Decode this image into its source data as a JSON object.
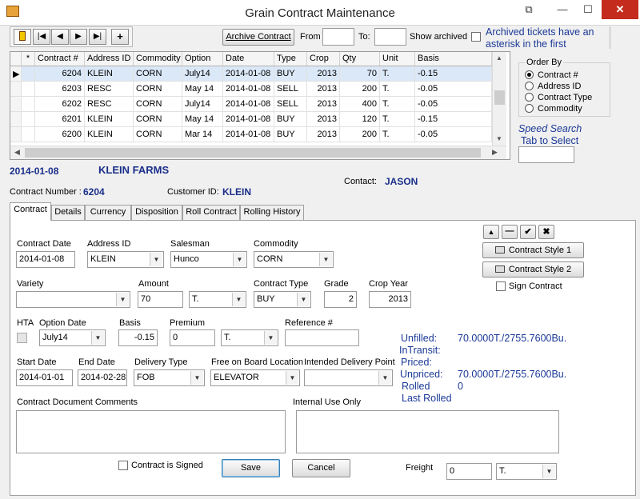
{
  "window": {
    "title": "Grain Contract Maintenance"
  },
  "toolbar": {
    "archive_button": "Archive Contract",
    "from_label": "From",
    "from_value": "",
    "to_label": "To:",
    "to_value": "",
    "show_archived_label": "Show archived",
    "show_archived_checked": false,
    "archived_note": "Archived tickets have an asterisk in the first"
  },
  "grid": {
    "columns": [
      "*",
      "Contract #",
      "Address ID",
      "Commodity",
      "Option",
      "Date",
      "Type",
      "Crop",
      "Qty",
      "Unit",
      "Basis"
    ],
    "rows": [
      {
        "star": "",
        "contract": "6204",
        "address": "KLEIN",
        "commodity": "CORN",
        "option": "July14",
        "date": "2014-01-08",
        "type": "BUY",
        "crop": "2013",
        "qty": "70",
        "unit": "T.",
        "basis": "-0.15",
        "selected": true
      },
      {
        "star": "",
        "contract": "6203",
        "address": "RESC",
        "commodity": "CORN",
        "option": "May 14",
        "date": "2014-01-08",
        "type": "SELL",
        "crop": "2013",
        "qty": "200",
        "unit": "T.",
        "basis": "-0.05"
      },
      {
        "star": "",
        "contract": "6202",
        "address": "RESC",
        "commodity": "CORN",
        "option": "July14",
        "date": "2014-01-08",
        "type": "SELL",
        "crop": "2013",
        "qty": "400",
        "unit": "T.",
        "basis": "-0.05"
      },
      {
        "star": "",
        "contract": "6201",
        "address": "KLEIN",
        "commodity": "CORN",
        "option": "May 14",
        "date": "2014-01-08",
        "type": "BUY",
        "crop": "2013",
        "qty": "120",
        "unit": "T.",
        "basis": "-0.15"
      },
      {
        "star": "",
        "contract": "6200",
        "address": "KLEIN",
        "commodity": "CORN",
        "option": "Mar 14",
        "date": "2014-01-08",
        "type": "BUY",
        "crop": "2013",
        "qty": "200",
        "unit": "T.",
        "basis": "-0.05"
      }
    ]
  },
  "order_by": {
    "title": "Order By",
    "options": [
      "Contract #",
      "Address ID",
      "Contract Type",
      "Commodity"
    ],
    "selected": "Contract #"
  },
  "speed_search": {
    "label": "Speed Search",
    "hint": "Tab to Select",
    "value": ""
  },
  "header": {
    "date": "2014-01-08",
    "customer_name": "KLEIN FARMS",
    "contact_label": "Contact:",
    "contact_value": "JASON",
    "contract_number_label": "Contract Number :",
    "contract_number_value": "6204",
    "customer_id_label": "Customer ID:",
    "customer_id_value": "KLEIN"
  },
  "tabs": [
    "Contract",
    "Details",
    "Currency",
    "Disposition",
    "Roll Contract",
    "Rolling History"
  ],
  "active_tab": "Contract",
  "form": {
    "contract_date": {
      "label": "Contract Date",
      "value": "2014-01-08"
    },
    "address_id": {
      "label": "Address ID",
      "value": "KLEIN"
    },
    "salesman": {
      "label": "Salesman",
      "value": "Hunco"
    },
    "commodity": {
      "label": "Commodity",
      "value": "CORN"
    },
    "variety": {
      "label": "Variety",
      "value": ""
    },
    "amount": {
      "label": "Amount",
      "value": "70",
      "unit": "T."
    },
    "contract_type": {
      "label": "Contract Type",
      "value": "BUY"
    },
    "grade": {
      "label": "Grade",
      "value": "2"
    },
    "crop_year": {
      "label": "Crop Year",
      "value": "2013"
    },
    "hta": {
      "label": "HTA",
      "checked": false
    },
    "option_date": {
      "label": "Option Date",
      "value": "July14"
    },
    "basis": {
      "label": "Basis",
      "value": "-0.15"
    },
    "premium": {
      "label": "Premium",
      "value": "0",
      "unit": "T."
    },
    "reference": {
      "label": "Reference #",
      "value": ""
    },
    "start_date": {
      "label": "Start Date",
      "value": "2014-01-01"
    },
    "end_date": {
      "label": "End Date",
      "value": "2014-02-28"
    },
    "delivery_type": {
      "label": "Delivery Type",
      "value": "FOB"
    },
    "fob_location": {
      "label": "Free on Board Location",
      "value": "ELEVATOR"
    },
    "intended_delivery": {
      "label": "Intended Delivery Point",
      "value": ""
    },
    "doc_comments": {
      "label": "Contract Document Comments",
      "value": ""
    },
    "internal_use": {
      "label": "Internal Use Only",
      "value": ""
    },
    "contract_signed": {
      "label": "Contract is Signed",
      "checked": false
    },
    "sign_contract": {
      "label": "Sign Contract",
      "checked": false
    },
    "freight": {
      "label": "Freight",
      "value": "0",
      "unit": "T."
    }
  },
  "styles": {
    "style1": "Contract Style 1",
    "style2": "Contract Style 2"
  },
  "buttons": {
    "save": "Save",
    "cancel": "Cancel"
  },
  "status": {
    "unfilled_label": "Unfilled:",
    "unfilled_value": "70.0000T./2755.7600Bu.",
    "intransit_label": "InTransit:",
    "priced_label": "Priced:",
    "unpriced_label": "Unpriced:",
    "unpriced_value": "70.0000T./2755.7600Bu.",
    "rolled_label": "Rolled",
    "rolled_value": "0",
    "last_rolled_label": "Last Rolled"
  },
  "colors": {
    "accent": "#1a3896",
    "selected_row": "#dbe8f8",
    "close": "#c42b1c"
  }
}
